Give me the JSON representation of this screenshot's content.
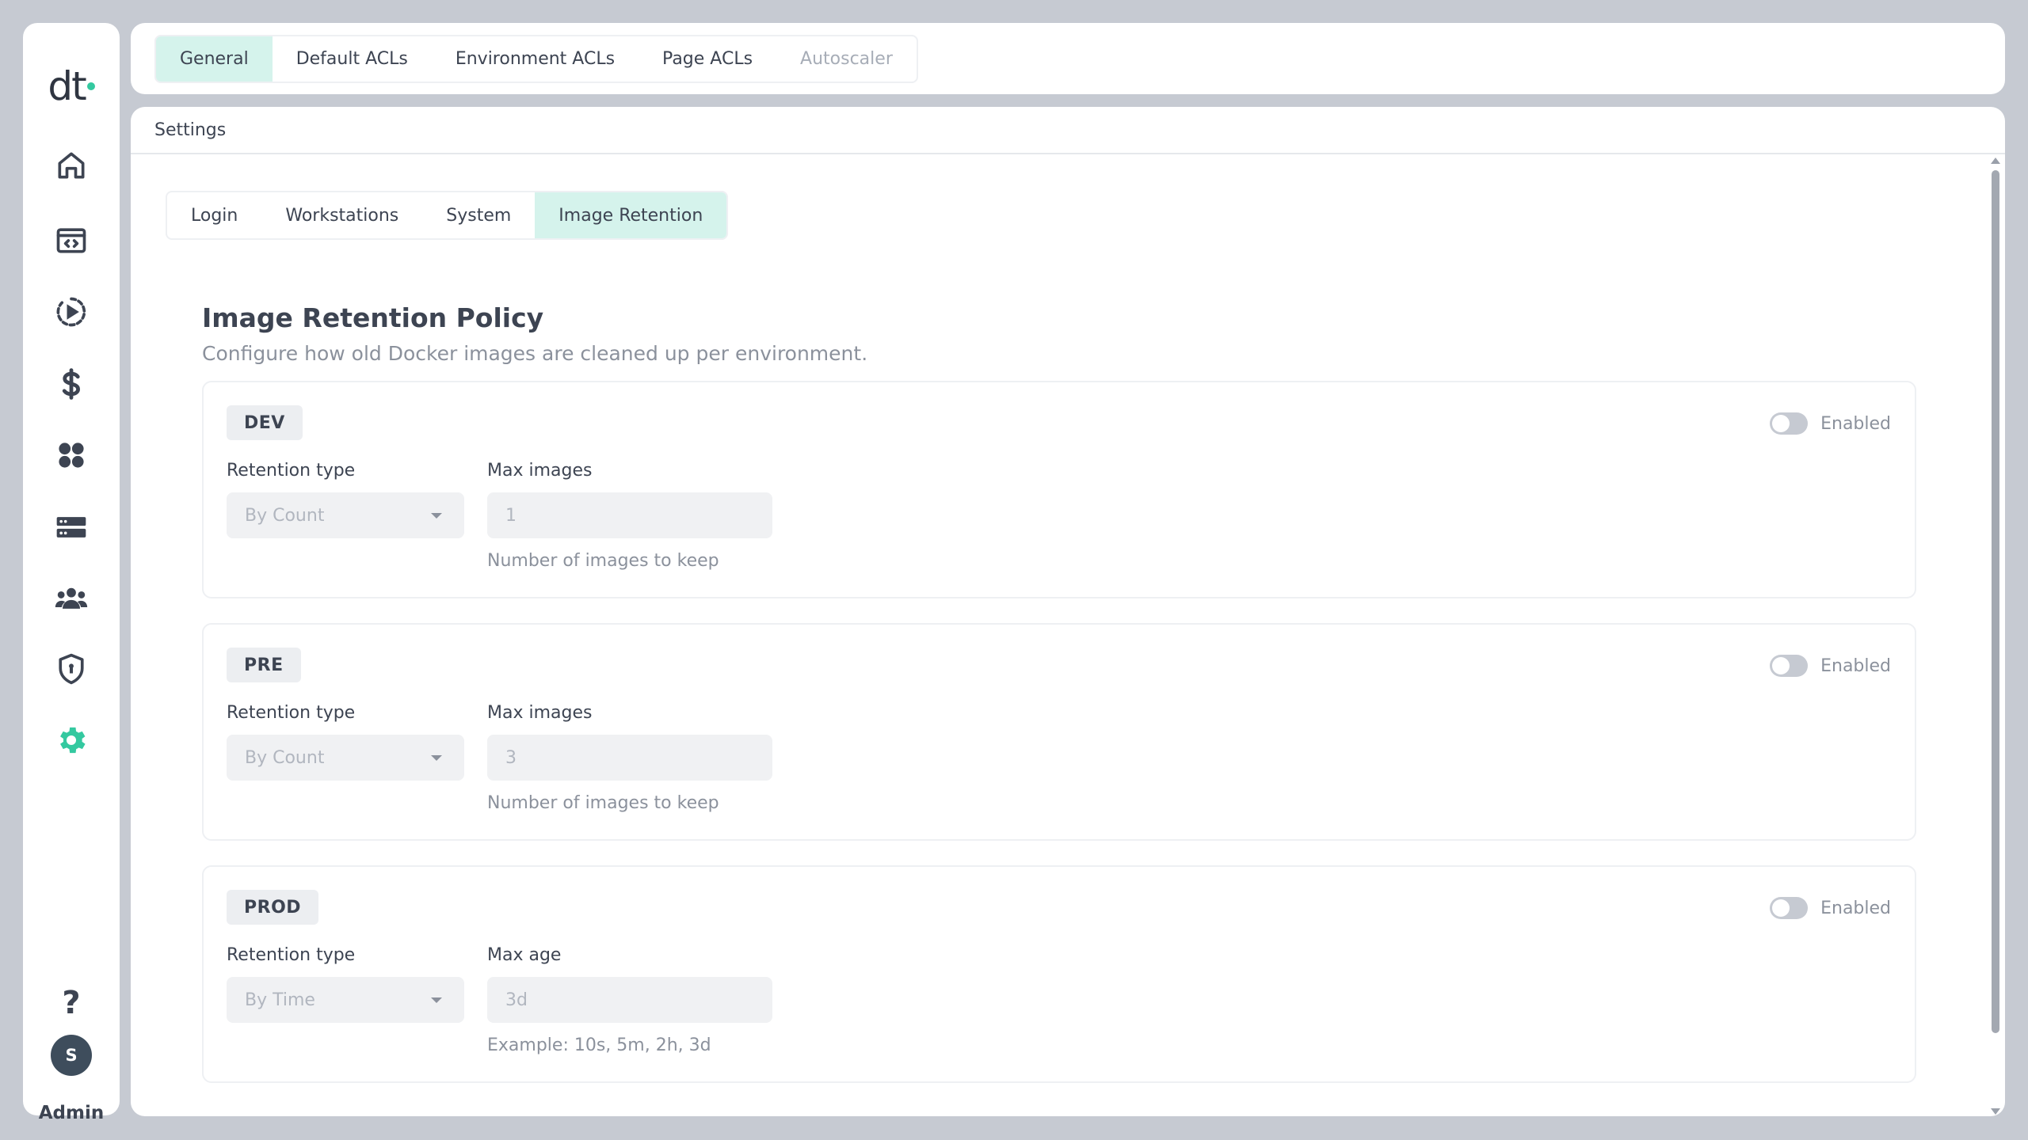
{
  "sidebar": {
    "logo_text": "dt",
    "user_initial": "S",
    "user_label": "Admin",
    "help_glyph": "?",
    "accent_color": "#34c9a0",
    "items": [
      {
        "icon": "home-icon"
      },
      {
        "icon": "code-window-icon"
      },
      {
        "icon": "play-circle-icon"
      },
      {
        "icon": "dollar-icon"
      },
      {
        "icon": "apps-icon"
      },
      {
        "icon": "server-icon"
      },
      {
        "icon": "users-icon"
      },
      {
        "icon": "shield-icon"
      },
      {
        "icon": "gear-icon"
      }
    ]
  },
  "top_tabs": [
    {
      "label": "General",
      "active": true
    },
    {
      "label": "Default ACLs"
    },
    {
      "label": "Environment ACLs"
    },
    {
      "label": "Page ACLs"
    },
    {
      "label": "Autoscaler",
      "disabled": true
    }
  ],
  "panel": {
    "title": "Settings",
    "sub_tabs": [
      {
        "label": "Login"
      },
      {
        "label": "Workstations"
      },
      {
        "label": "System"
      },
      {
        "label": "Image Retention",
        "active": true
      }
    ],
    "policy_title": "Image Retention Policy",
    "policy_desc": "Configure how old Docker images are cleaned up per environment.",
    "envs": [
      {
        "name": "DEV",
        "toggle_label": "Enabled",
        "type_label": "Retention type",
        "type_value": "By Count",
        "value_label": "Max images",
        "value": "1",
        "helper": "Number of images to keep"
      },
      {
        "name": "PRE",
        "toggle_label": "Enabled",
        "type_label": "Retention type",
        "type_value": "By Count",
        "value_label": "Max images",
        "value": "3",
        "helper": "Number of images to keep"
      },
      {
        "name": "PROD",
        "toggle_label": "Enabled",
        "type_label": "Retention type",
        "type_value": "By Time",
        "value_label": "Max age",
        "value": "3d",
        "helper": "Example: 10s, 5m, 2h, 3d"
      }
    ]
  }
}
